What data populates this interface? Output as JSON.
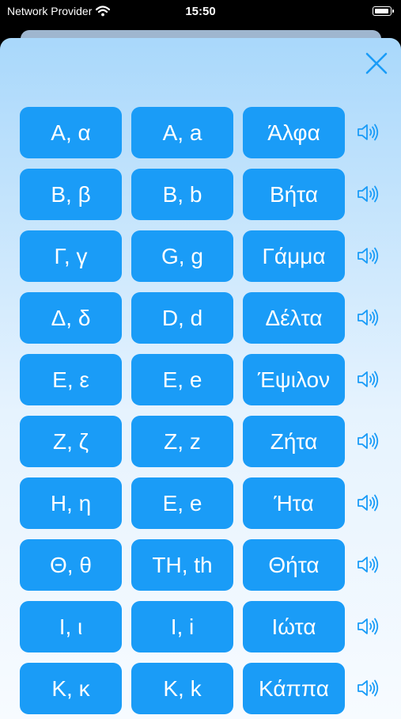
{
  "status": {
    "carrier": "Network Provider",
    "time": "15:50"
  },
  "icons": {
    "close": "close-icon",
    "speaker": "speaker-icon",
    "wifi": "wifi-icon",
    "battery": "battery-icon"
  },
  "colors": {
    "button": "#1a9cf7",
    "accent": "#1a9cf7"
  },
  "rows": [
    {
      "greek": "Α, α",
      "latin": "A, a",
      "name": "Άλφα"
    },
    {
      "greek": "Β, β",
      "latin": "B, b",
      "name": "Βήτα"
    },
    {
      "greek": "Γ, γ",
      "latin": "G, g",
      "name": "Γάμμα"
    },
    {
      "greek": "Δ, δ",
      "latin": "D, d",
      "name": "Δέλτα"
    },
    {
      "greek": "Ε, ε",
      "latin": "E, e",
      "name": "Έψιλον"
    },
    {
      "greek": "Ζ, ζ",
      "latin": "Z, z",
      "name": "Ζήτα"
    },
    {
      "greek": "Η, η",
      "latin": "E, e",
      "name": "Ήτα"
    },
    {
      "greek": "Θ, θ",
      "latin": "TH, th",
      "name": "Θήτα"
    },
    {
      "greek": "Ι, ι",
      "latin": "I, i",
      "name": "Ιώτα"
    },
    {
      "greek": "Κ, κ",
      "latin": "K, k",
      "name": "Κάππα"
    }
  ]
}
